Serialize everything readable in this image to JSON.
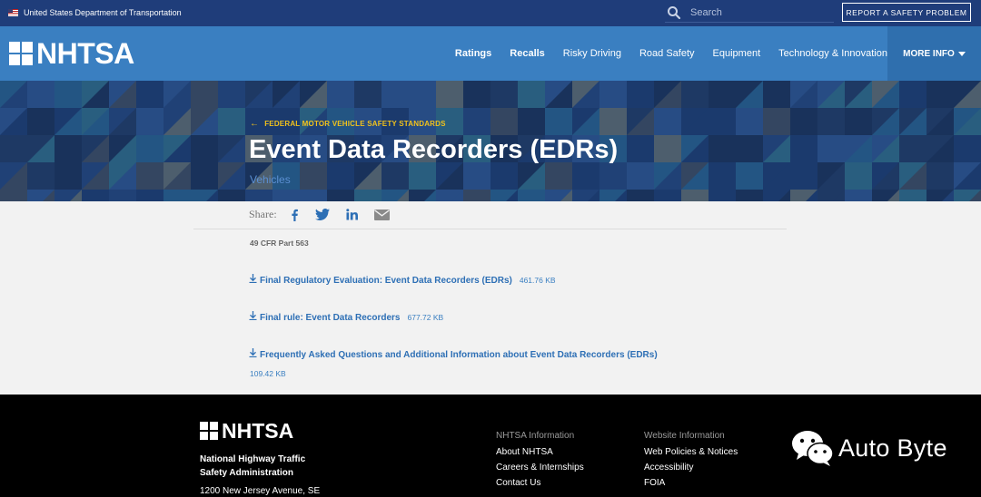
{
  "topbar": {
    "dot_label": "United States Department of Transportation",
    "search_placeholder": "Search",
    "report_button": "REPORT A SAFETY PROBLEM"
  },
  "nav": {
    "logo": "NHTSA",
    "links": [
      "Ratings",
      "Recalls",
      "Risky Driving",
      "Road Safety",
      "Equipment",
      "Technology & Innovation"
    ],
    "more_info": "MORE INFO"
  },
  "hero": {
    "breadcrumb": "FEDERAL MOTOR VEHICLE SAFETY STANDARDS",
    "title": "Event Data Recorders (EDRs)",
    "subtitle": "Vehicles"
  },
  "share": {
    "label": "Share:",
    "icons": [
      "facebook-icon",
      "twitter-icon",
      "linkedin-icon",
      "email-icon"
    ]
  },
  "content": {
    "cfr": "49 CFR Part 563",
    "downloads": [
      {
        "title": "Final Regulatory Evaluation: Event Data Recorders (EDRs)",
        "size": "461.76 KB"
      },
      {
        "title": "Final rule: Event Data Recorders",
        "size": "677.72 KB"
      },
      {
        "title": "Frequently Asked Questions and Additional Information about Event Data Recorders (EDRs)",
        "size": "109.42 KB"
      }
    ]
  },
  "footer": {
    "logo": "NHTSA",
    "org": "National Highway Traffic Safety Administration",
    "address": "1200 New Jersey Avenue, SE",
    "col1": {
      "heading": "NHTSA Information",
      "links": [
        "About NHTSA",
        "Careers & Internships",
        "Contact Us"
      ]
    },
    "col2": {
      "heading": "Website Information",
      "links": [
        "Web Policies & Notices",
        "Accessibility",
        "FOIA"
      ]
    },
    "watermark": "Auto Byte"
  },
  "colors": {
    "topbar": "#1f3d7a",
    "nav": "#3a7fc1",
    "link": "#2d6fb5",
    "breadcrumb": "#f2c21b"
  }
}
